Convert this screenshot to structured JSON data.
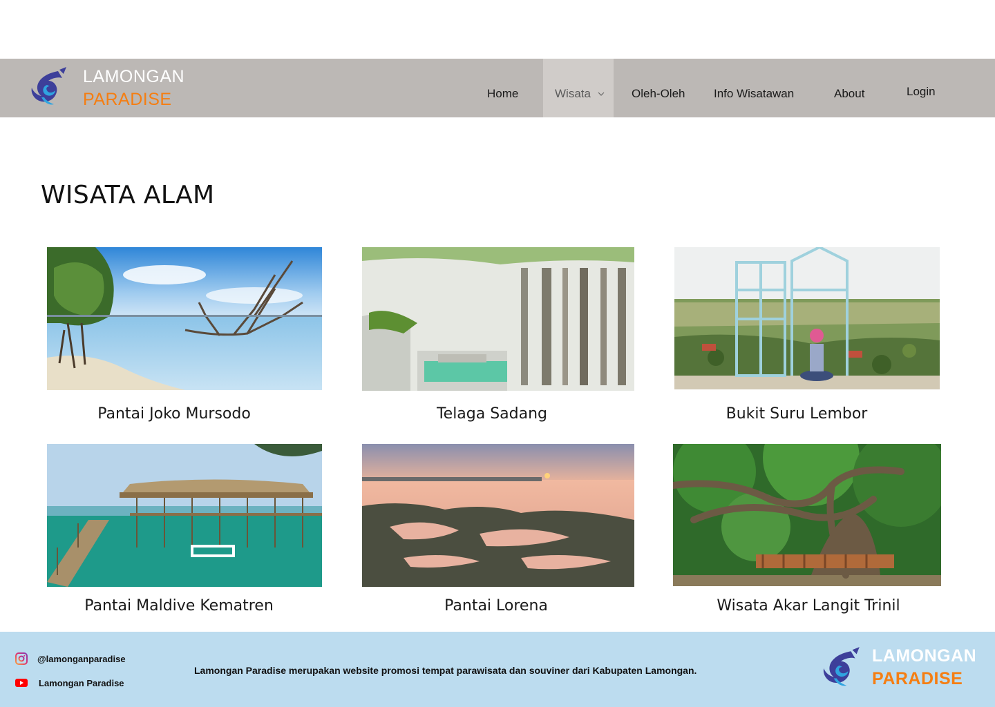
{
  "brand": {
    "line1": "LAMONGAN",
    "line2": "PARADISE"
  },
  "nav": {
    "home": "Home",
    "wisata": "Wisata",
    "oleh_oleh": "Oleh-Oleh",
    "info": "Info Wisatawan",
    "about": "About",
    "login": "Login"
  },
  "page": {
    "heading": "WISATA ALAM"
  },
  "destinations": [
    {
      "name": "Pantai Joko Mursodo"
    },
    {
      "name": "Telaga Sadang"
    },
    {
      "name": "Bukit Suru Lembor"
    },
    {
      "name": "Pantai Maldive Kematren"
    },
    {
      "name": "Pantai Lorena"
    },
    {
      "name": "Wisata Akar Langit Trinil"
    }
  ],
  "footer": {
    "instagram": "@lamonganparadise",
    "youtube": "Lamongan Paradise",
    "tagline": "Lamongan Paradise merupakan website promosi tempat parawisata dan souviner dari Kabupaten Lamongan.",
    "brand_line1": "LAMONGAN",
    "brand_line2": "PARADISE"
  },
  "colors": {
    "navbar": "#bcb8b5",
    "nav_active": "#d0ccc9",
    "accent_orange": "#f57e12",
    "footer": "#bcdcef"
  }
}
